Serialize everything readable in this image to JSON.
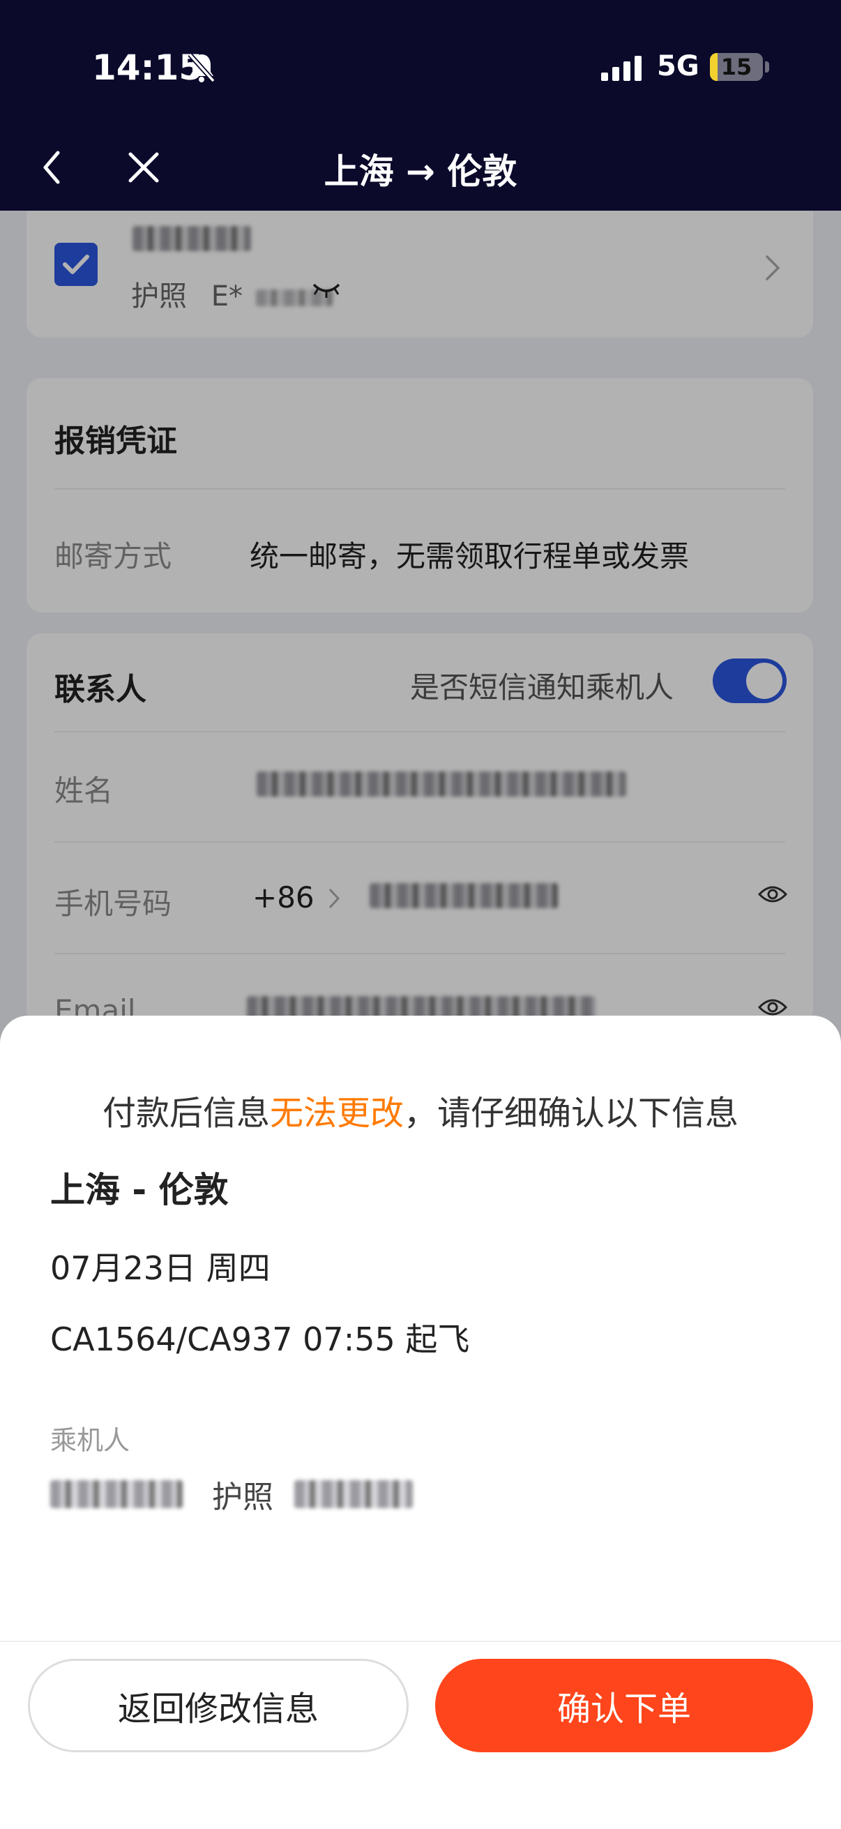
{
  "status_bar": {
    "time": "14:15",
    "network": "5G",
    "battery": "15",
    "battery_level": 0.15
  },
  "nav": {
    "title": "上海 → 伦敦"
  },
  "passenger_card": {
    "doc_type": "护照",
    "doc_number": "E*"
  },
  "receipt": {
    "title": "报销凭证",
    "mail_label": "邮寄方式",
    "mail_value": "统一邮寄，无需领取行程单或发票"
  },
  "contact": {
    "title": "联系人",
    "sms_label": "是否短信通知乘机人",
    "sms_enabled": true,
    "name_label": "姓名",
    "phone_label": "手机号码",
    "country_code": "+86",
    "email_label": "Email"
  },
  "sheet": {
    "warning_prefix": "付款后信息",
    "warning_highlight": "无法更改",
    "warning_suffix": "，请仔细确认以下信息",
    "route": "上海 - 伦敦",
    "date": "07月23日 周四",
    "flight": "CA1564/CA937 07:55 起飞",
    "passenger_label": "乘机人",
    "passenger_doc_type": "护照",
    "back_button": "返回修改信息",
    "confirm_button": "确认下单"
  },
  "colors": {
    "header_bg": "#0b0a2b",
    "accent_blue": "#2c56e0",
    "confirm_orange": "#ff451b",
    "warning_orange": "#ff7a00"
  }
}
